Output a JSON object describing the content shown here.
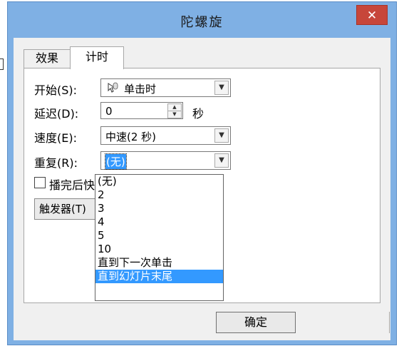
{
  "window": {
    "title": "陀螺旋",
    "close_glyph": "✕"
  },
  "tabs": [
    {
      "label": "效果",
      "active": false
    },
    {
      "label": "计时",
      "active": true
    }
  ],
  "start": {
    "label": "开始(S):",
    "value": "单击时",
    "icon": "mouse-icon"
  },
  "delay": {
    "label": "延迟(D):",
    "value": "0",
    "unit": "秒"
  },
  "speed": {
    "label": "速度(E):",
    "value": "中速(2 秒)"
  },
  "repeat": {
    "label": "重复(R):",
    "value": "(无)",
    "options": [
      "(无)",
      "2",
      "3",
      "4",
      "5",
      "10",
      "直到下一次单击",
      "直到幻灯片末尾"
    ],
    "highlighted_index": 7
  },
  "rewind": {
    "label": "播完后快",
    "checked": false
  },
  "trigger": {
    "label": "触发器(T)"
  },
  "buttons": {
    "ok": "确定"
  },
  "colors": {
    "titlebar": "#7fb0e4",
    "close": "#c7463a",
    "selection": "#3399ff"
  }
}
